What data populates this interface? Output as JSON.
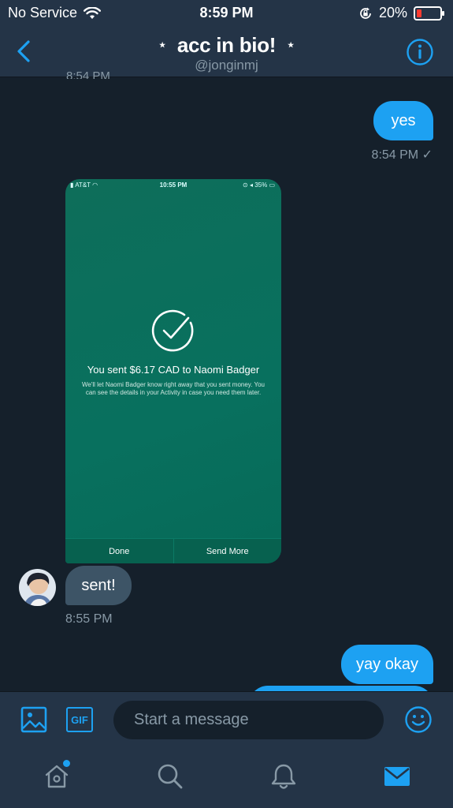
{
  "status_bar": {
    "carrier": "No Service",
    "time": "8:59 PM",
    "battery": "20%",
    "battery_level": 0.2
  },
  "header": {
    "title": "acc in bio!",
    "title_decoration": "⋆",
    "handle": "@jonginmj"
  },
  "conversation": {
    "cut_off_timestamp": "8:54 PM",
    "messages": [
      {
        "side": "right",
        "text": "yes",
        "time": "8:54 PM",
        "status": "✓"
      },
      {
        "side": "left",
        "type": "image"
      },
      {
        "side": "left",
        "text": "sent!",
        "time": "8:55 PM"
      },
      {
        "side": "right",
        "text": "yay okay"
      }
    ]
  },
  "media_screenshot": {
    "carrier": "AT&T",
    "time": "10:55 PM",
    "battery": "35%",
    "title": "You sent $6.17 CAD to Naomi Badger",
    "description": "We'll let Naomi Badger know right away that you sent money. You can see the details in your Activity in case you need them later.",
    "buttons": [
      "Done",
      "Send More"
    ]
  },
  "composer": {
    "gif_label": "GIF",
    "placeholder": "Start a message"
  },
  "tabs": [
    "home",
    "search",
    "notifications",
    "messages"
  ],
  "colors": {
    "accent": "#1da1f2",
    "background": "#15202b",
    "bar": "#243447",
    "incoming_bubble": "#3d5466",
    "secondary_text": "#8899a6",
    "media_green": "#08705e"
  }
}
